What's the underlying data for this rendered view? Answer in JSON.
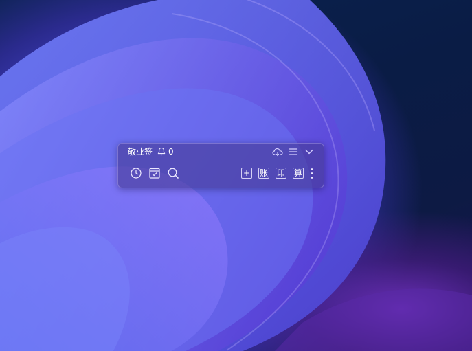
{
  "widget": {
    "title": "敬业签",
    "reminder_count": "0",
    "header_icons": [
      "cloud-sync-icon",
      "menu-icon",
      "chevron-down-icon"
    ],
    "tool_icons": [
      "clock-icon",
      "calendar-check-icon",
      "search-icon"
    ],
    "buttons": {
      "add": "+",
      "ledger": "账",
      "print": "印",
      "calc": "算"
    }
  },
  "colors": {
    "wallpaper_accent": "#5a5ee8",
    "wallpaper_dark": "#0a1c45",
    "widget_bg": "#463a96"
  }
}
